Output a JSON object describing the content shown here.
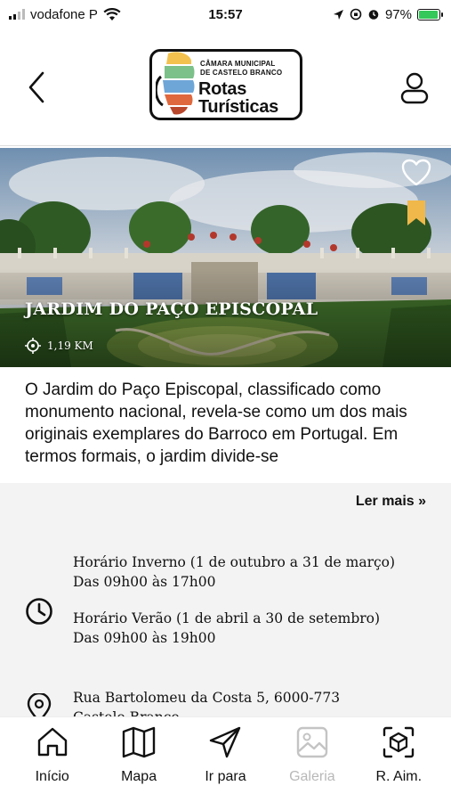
{
  "status_bar": {
    "carrier": "vodafone P",
    "time": "15:57",
    "battery_percent": "97%",
    "battery_level": 0.97
  },
  "header": {
    "logo": {
      "org_line1": "CÂMARA MUNICIPAL",
      "org_line2": "DE CASTELO BRANCO",
      "title_line1": "Rotas",
      "title_line2": "Turísticas"
    }
  },
  "hero": {
    "title": "JARDIM DO PAÇO EPISCOPAL",
    "distance": "1,19 KM",
    "bookmark_color": "#f0b84a"
  },
  "description": {
    "text": "O Jardim do Paço Episcopal, classificado como monumento nacional, revela-se como um dos mais originais exemplares do Barroco em Portugal. Em termos formais, o jardim divide-se",
    "read_more": "Ler mais »"
  },
  "hours": {
    "winter_label": "Horário Inverno (1 de outubro a 31 de março)",
    "winter_time": "Das 09h00 às 17h00",
    "summer_label": "Horário Verão (1 de abril a 30 de setembro)",
    "summer_time": "Das 09h00 às 19h00"
  },
  "address": {
    "line1": "Rua Bartolomeu da Costa 5, 6000-773",
    "line2": "Castelo Branco"
  },
  "bottom_nav": {
    "home": "Início",
    "map": "Mapa",
    "goto": "Ir para",
    "gallery": "Galeria",
    "ar": "R. Aim."
  }
}
